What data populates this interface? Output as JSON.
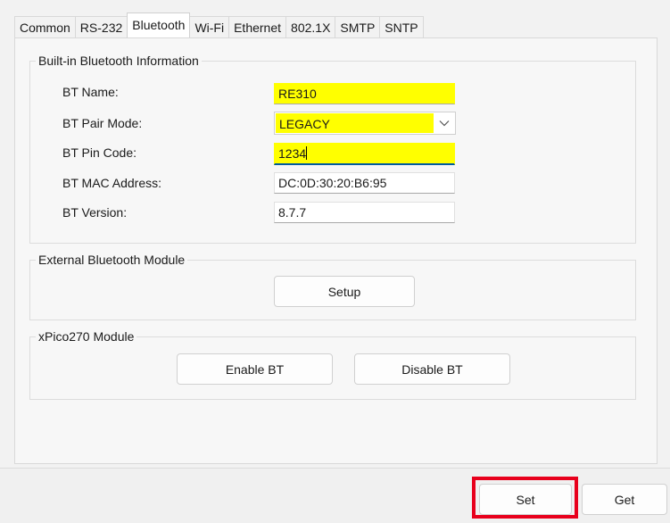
{
  "tabs": [
    {
      "label": "Common"
    },
    {
      "label": "RS-232"
    },
    {
      "label": "Bluetooth",
      "active": true
    },
    {
      "label": "Wi-Fi"
    },
    {
      "label": "Ethernet"
    },
    {
      "label": "802.1X"
    },
    {
      "label": "SMTP"
    },
    {
      "label": "SNTP"
    }
  ],
  "builtin": {
    "title": "Built-in Bluetooth Information",
    "bt_name": {
      "label": "BT Name:",
      "value": "RE310"
    },
    "bt_pair_mode": {
      "label": "BT Pair Mode:",
      "value": "LEGACY"
    },
    "bt_pin_code": {
      "label": "BT Pin Code:",
      "value": "1234"
    },
    "bt_mac": {
      "label": "BT MAC Address:",
      "value": "DC:0D:30:20:B6:95"
    },
    "bt_version": {
      "label": "BT Version:",
      "value": "8.7.7"
    }
  },
  "external": {
    "title": "External Bluetooth Module",
    "setup_label": "Setup"
  },
  "xpico": {
    "title": "xPico270 Module",
    "enable_label": "Enable BT",
    "disable_label": "Disable BT"
  },
  "footer": {
    "set_label": "Set",
    "get_label": "Get"
  },
  "colors": {
    "highlight_field": "#ffff00",
    "annotation_box": "#e8001c",
    "focus_underline": "#005a9e"
  }
}
